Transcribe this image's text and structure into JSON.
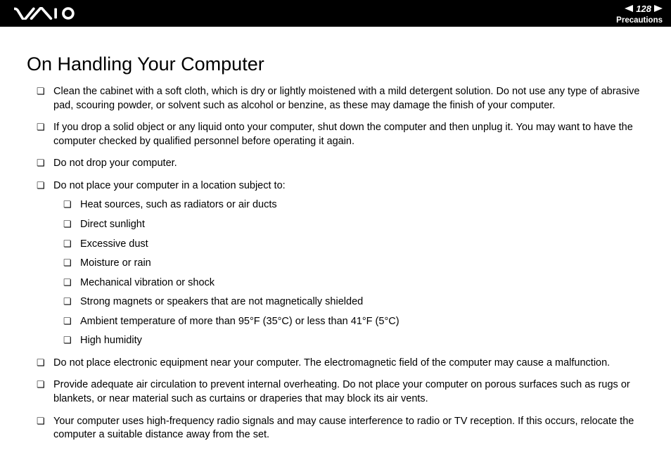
{
  "header": {
    "page_number": "128",
    "section": "Precautions"
  },
  "title": "On Handling Your Computer",
  "bullets": [
    {
      "text": "Clean the cabinet with a soft cloth, which is dry or lightly moistened with a mild detergent solution. Do not use any type of abrasive pad, scouring powder, or solvent such as alcohol or benzine, as these may damage the finish of your computer."
    },
    {
      "text": "If you drop a solid object or any liquid onto your computer, shut down the computer and then unplug it. You may want to have the computer checked by qualified personnel before operating it again."
    },
    {
      "text": "Do not drop your computer."
    },
    {
      "text": "Do not place your computer in a location subject to:",
      "children": [
        "Heat sources, such as radiators or air ducts",
        "Direct sunlight",
        "Excessive dust",
        "Moisture or rain",
        "Mechanical vibration or shock",
        "Strong magnets or speakers that are not magnetically shielded",
        "Ambient temperature of more than 95°F (35°C) or less than 41°F (5°C)",
        "High humidity"
      ]
    },
    {
      "text": "Do not place electronic equipment near your computer. The electromagnetic field of the computer may cause a malfunction."
    },
    {
      "text": "Provide adequate air circulation to prevent internal overheating. Do not place your computer on porous surfaces such as rugs or blankets, or near material such as curtains or draperies that may block its air vents."
    },
    {
      "text": "Your computer uses high-frequency radio signals and may cause interference to radio or TV reception. If this occurs, relocate the computer a suitable distance away from the set."
    }
  ]
}
